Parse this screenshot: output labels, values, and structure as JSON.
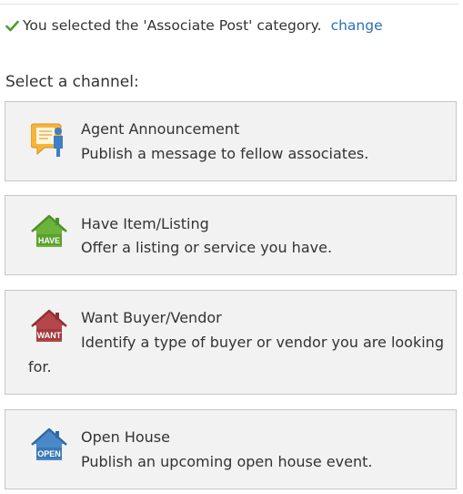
{
  "status": {
    "message": "You selected the 'Associate Post' category.",
    "change_label": "change",
    "check_color": "#4a9d2f"
  },
  "prompt": "Select a channel:",
  "channels": [
    {
      "title": "Agent Announcement",
      "description": "Publish a message to fellow associates.",
      "icon": "announcement-icon",
      "color": "#f5b53a"
    },
    {
      "title": "Have Item/Listing",
      "description": "Offer a listing or service you have.",
      "icon": "house-have-icon",
      "badge": "HAVE",
      "color": "#6bb33a"
    },
    {
      "title": "Want Buyer/Vendor",
      "description": "Identify a type of buyer or vendor you are looking",
      "description_cont": "for.",
      "icon": "house-want-icon",
      "badge": "WANT",
      "color": "#b5474a"
    },
    {
      "title": "Open House",
      "description": "Publish an upcoming open house event.",
      "icon": "house-open-icon",
      "badge": "OPEN",
      "color": "#4a89c6"
    }
  ]
}
